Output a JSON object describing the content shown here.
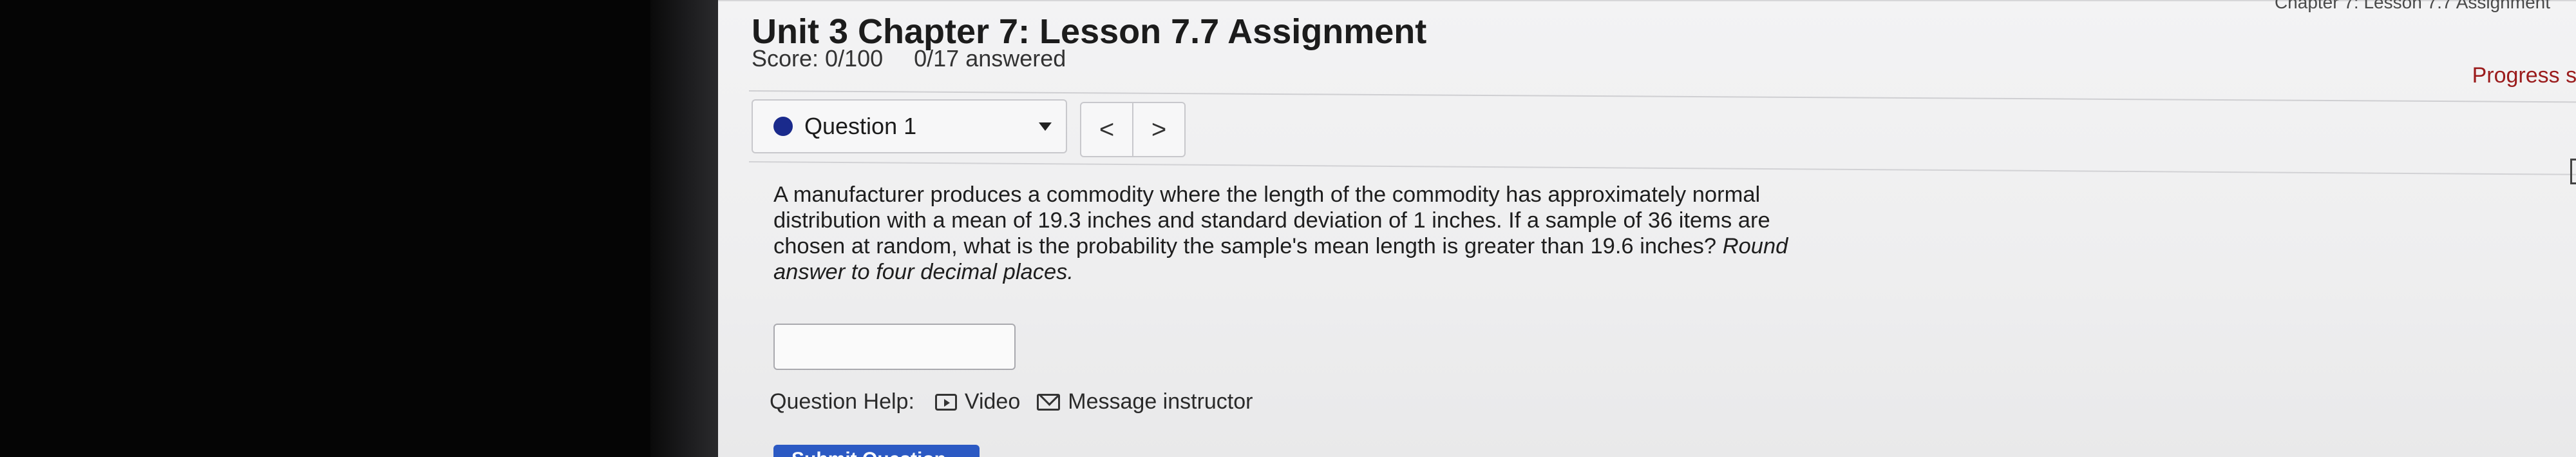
{
  "header": {
    "breadcrumb": "Chapter 7: Lesson 7.7 Assignment",
    "title": "Unit 3 Chapter 7: Lesson 7.7 Assignment",
    "score": "Score: 0/100",
    "answered": "0/17 answered",
    "progress": "Progress sa"
  },
  "question_nav": {
    "selected": "Question 1",
    "prev_label": "<",
    "next_label": ">"
  },
  "question": {
    "text": "A manufacturer produces a commodity where the length of the commodity has approximately normal distribution with a mean of 19.3 inches and standard deviation of 1 inches. If a sample of 36 items are chosen at random, what is the probability the sample's mean length is greater than 19.6 inches? ",
    "instruction": "Round answer to four decimal places.",
    "answer_value": ""
  },
  "help": {
    "label": "Question Help:",
    "video": "Video",
    "message": "Message instructor"
  },
  "submit": {
    "label": "Submit Question"
  },
  "colors": {
    "accent_dot": "#1a2a8c",
    "progress_text": "#9b1c1c",
    "submit_bg": "#2b59c3"
  }
}
